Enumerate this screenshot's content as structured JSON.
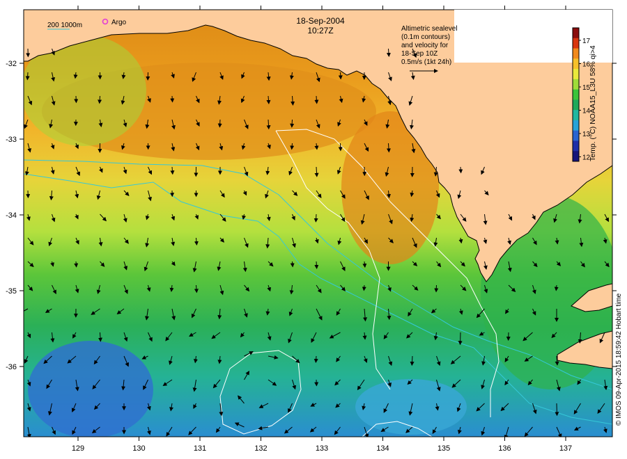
{
  "title": {
    "date": "18-Sep-2004",
    "time": "10:27Z"
  },
  "legend": {
    "scale_label": "200  1000m",
    "argo_label": "Argo",
    "altimetry_lines": [
      "Altimetric sealevel",
      "(0.1m contours)",
      "and velocity for",
      "18-Sep 10Z",
      "0.5m/s (1kt 24h)"
    ]
  },
  "colorbar": {
    "title": "Temp. (°C) NOAA15_L3U 58% qi>4",
    "ticks": [
      "17",
      "16",
      "15",
      "14",
      "13",
      "12"
    ],
    "colors": [
      "#8b0d0d",
      "#d9360f",
      "#f28a1c",
      "#f6c02a",
      "#e9e93c",
      "#9fdc38",
      "#3cc43a",
      "#1fa95a",
      "#20b8a0",
      "#28a3d8",
      "#2a64d0",
      "#1f2fa8",
      "#16157a"
    ]
  },
  "axes": {
    "x_ticks": [
      "129",
      "130",
      "131",
      "132",
      "133",
      "134",
      "135",
      "136",
      "137"
    ],
    "y_ticks": [
      "-32",
      "-33",
      "-34",
      "-35",
      "-36"
    ]
  },
  "credit": "© IMOS 09-Apr-2015 18:59:42 Hobart time",
  "colors": {
    "land": "#fdcc9c",
    "contour": "#ffffff",
    "isobath": "#35c8d8",
    "argo": "#e23cd6"
  }
}
